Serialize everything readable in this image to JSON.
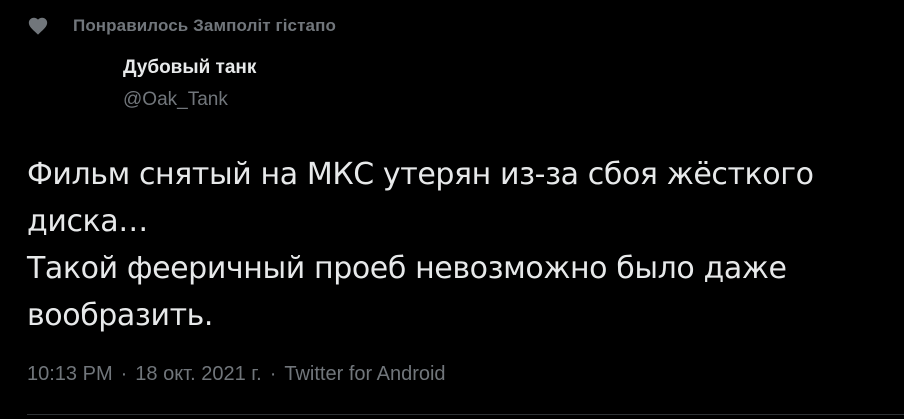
{
  "social_context": {
    "icon": "heart-icon",
    "text": "Понравилось Замполіт гістапо"
  },
  "author": {
    "name": "Дубовый танк",
    "handle": "@Oak_Tank"
  },
  "tweet": {
    "text": "Фильм снятый на МКС утерян из-за сбоя жёсткого диска…\nТакой фееричный проеб невозможно было даже вообразить."
  },
  "meta": {
    "time": "10:13 PM",
    "separator": "·",
    "date": "18 окт. 2021 г.",
    "source": "Twitter for Android"
  },
  "colors": {
    "background": "#000000",
    "primary_text": "#e7e9ea",
    "secondary_text": "#71767b",
    "divider": "#2f3336"
  }
}
